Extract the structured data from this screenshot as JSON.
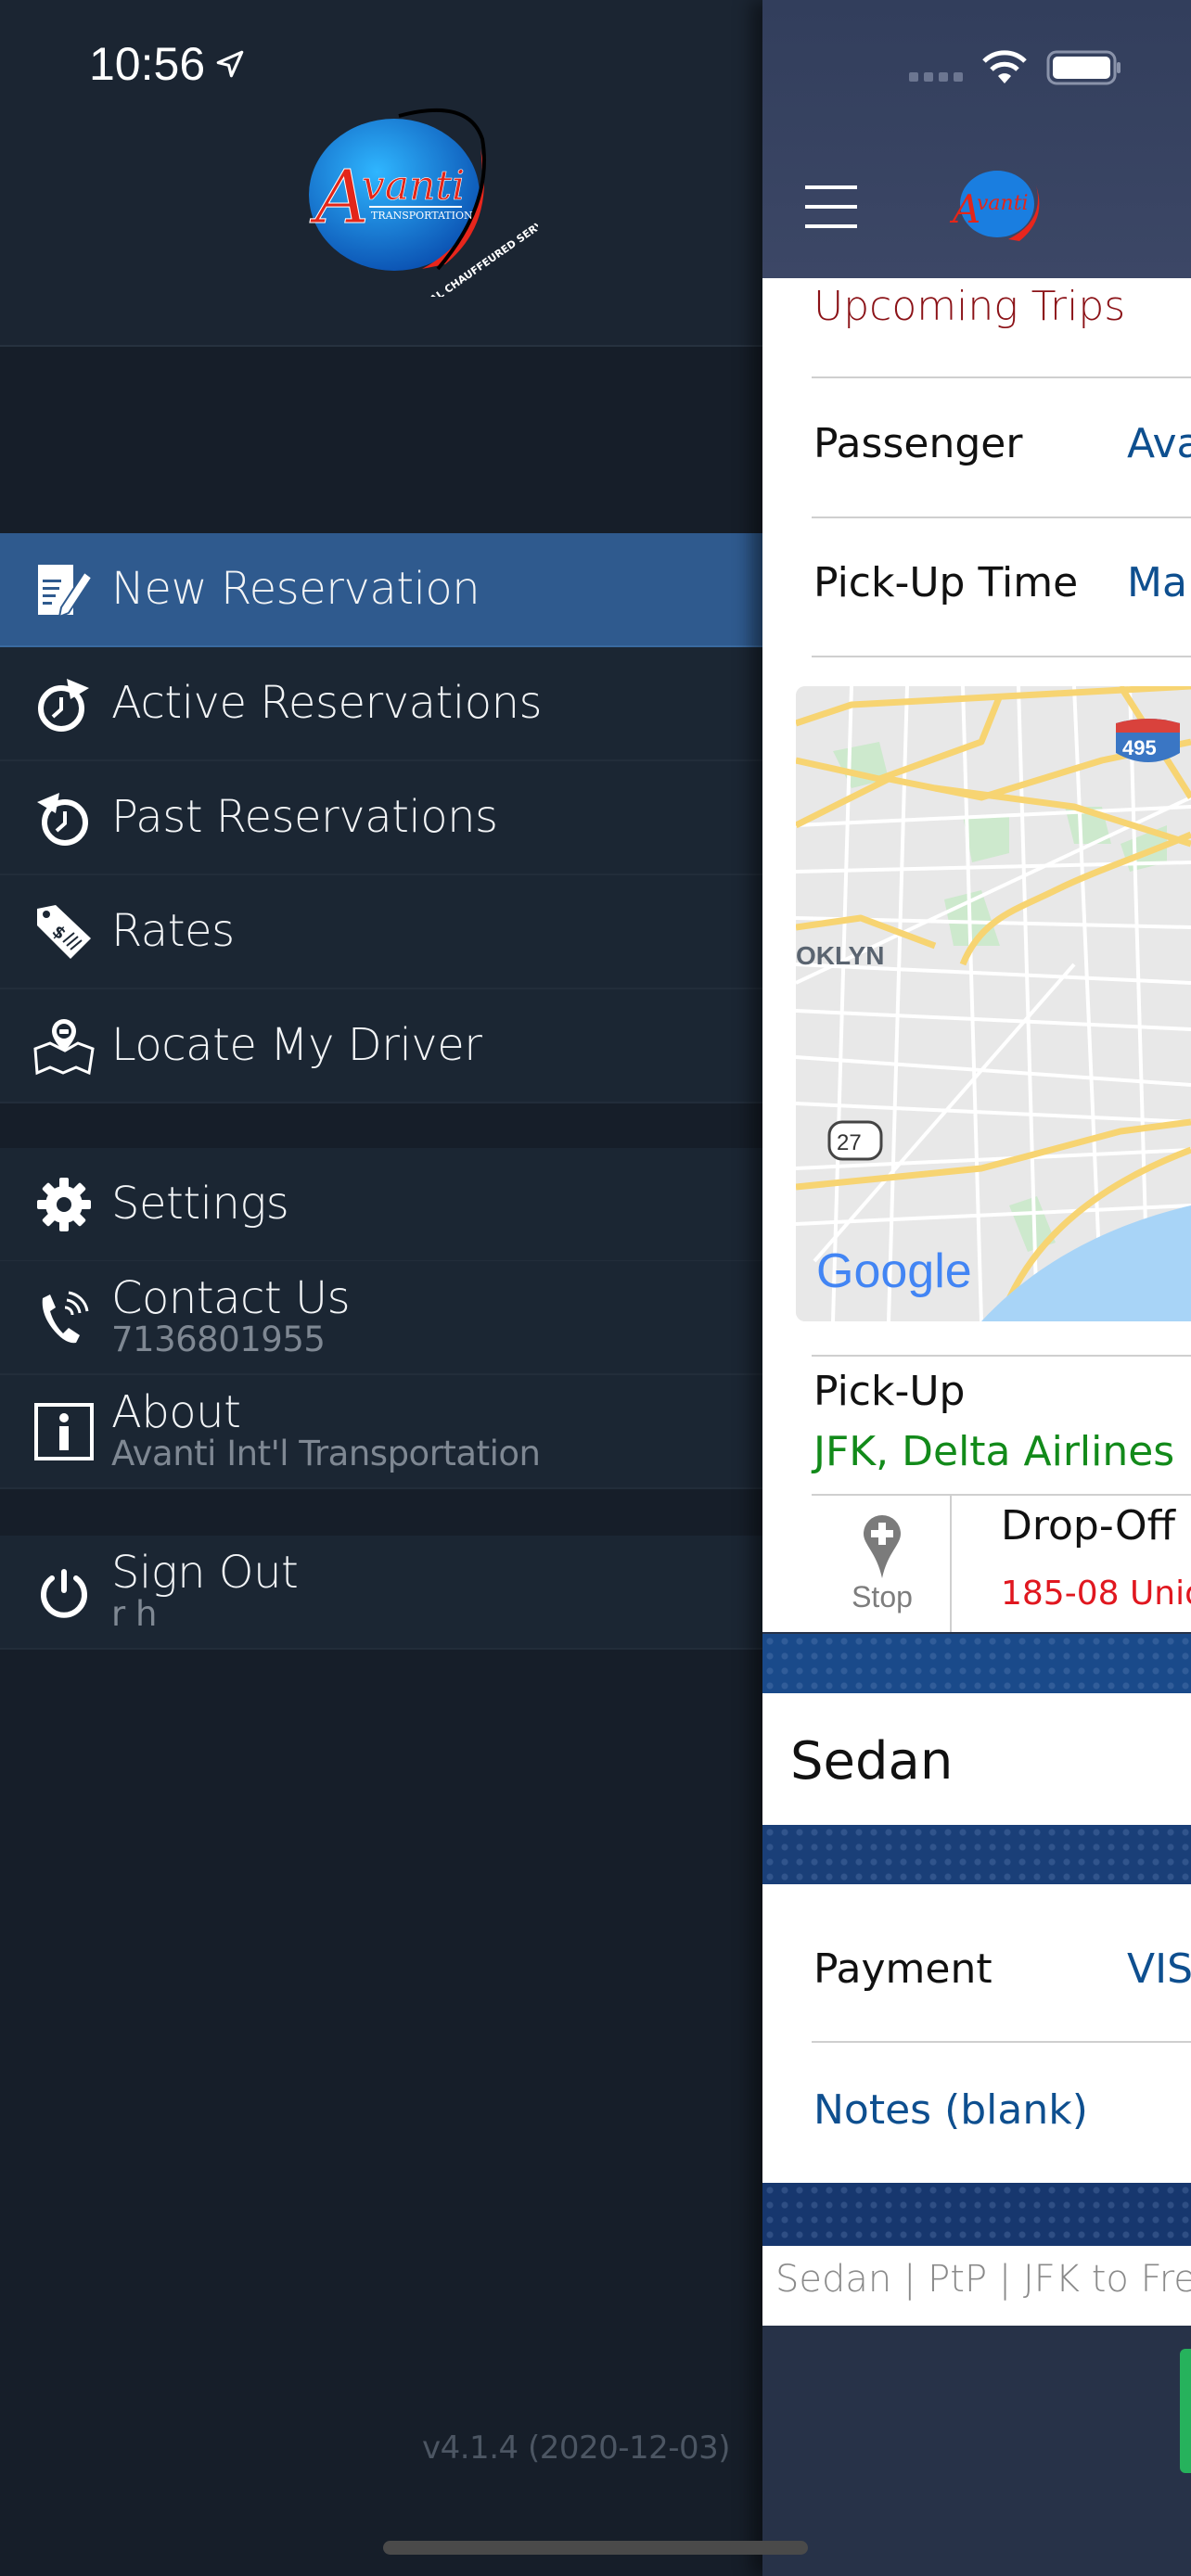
{
  "status_bar": {
    "time": "10:56",
    "location_icon": "location-arrow-icon",
    "wifi_icon": "wifi-icon",
    "battery_icon": "battery-icon",
    "signal_icon": "cellular-signal-icon"
  },
  "drawer": {
    "logo": {
      "name": "Avanti",
      "subtitle": "TRANSPORTATION",
      "tagline": "GLOBAL CHAUFFEURED SERVICES"
    },
    "menu_primary": [
      {
        "label": "New Reservation",
        "icon": "new-reservation-icon",
        "active": true
      },
      {
        "label": "Active Reservations",
        "icon": "clock-forward-icon",
        "active": false
      },
      {
        "label": "Past Reservations",
        "icon": "clock-back-icon",
        "active": false
      },
      {
        "label": "Rates",
        "icon": "price-tag-icon",
        "active": false
      },
      {
        "label": "Locate My Driver",
        "icon": "map-driver-icon",
        "active": false
      }
    ],
    "menu_secondary": [
      {
        "label": "Settings",
        "sub": "",
        "icon": "gear-icon"
      },
      {
        "label": "Contact Us",
        "sub": "7136801955",
        "icon": "phone-icon"
      },
      {
        "label": "About",
        "sub": "Avanti Int'l Transportation",
        "icon": "info-icon"
      }
    ],
    "sign_out": {
      "label": "Sign Out",
      "sub": "r h",
      "icon": "power-icon"
    },
    "version": "v4.1.4 (2020-12-03)"
  },
  "panel": {
    "section_title": "Upcoming Trips",
    "passenger": {
      "label": "Passenger",
      "value": "Ava"
    },
    "pickup_time": {
      "label": "Pick-Up Time",
      "value": "Ma"
    },
    "map": {
      "labels": {
        "area": "OKLYN",
        "interstate": "495",
        "route": "27",
        "brand": "Google"
      }
    },
    "pickup": {
      "label": "Pick-Up",
      "value": "JFK, Delta Airlines"
    },
    "stop": {
      "label": "Stop"
    },
    "dropoff": {
      "label": "Drop-Off",
      "value": "185-08 Unio"
    },
    "vehicle": "Sedan",
    "payment": {
      "label": "Payment",
      "value": "VIS"
    },
    "notes": "Notes (blank)",
    "summary": "Sedan | PtP | JFK to Fres"
  },
  "colors": {
    "drawer_bg": "#161e29",
    "active_item": "#2f5a8e",
    "section_title": "#8b1217",
    "value_blue": "#0e4f8f",
    "pickup_green": "#128a1a",
    "dropoff_red": "#e0171f",
    "button_green": "#26b25c"
  }
}
